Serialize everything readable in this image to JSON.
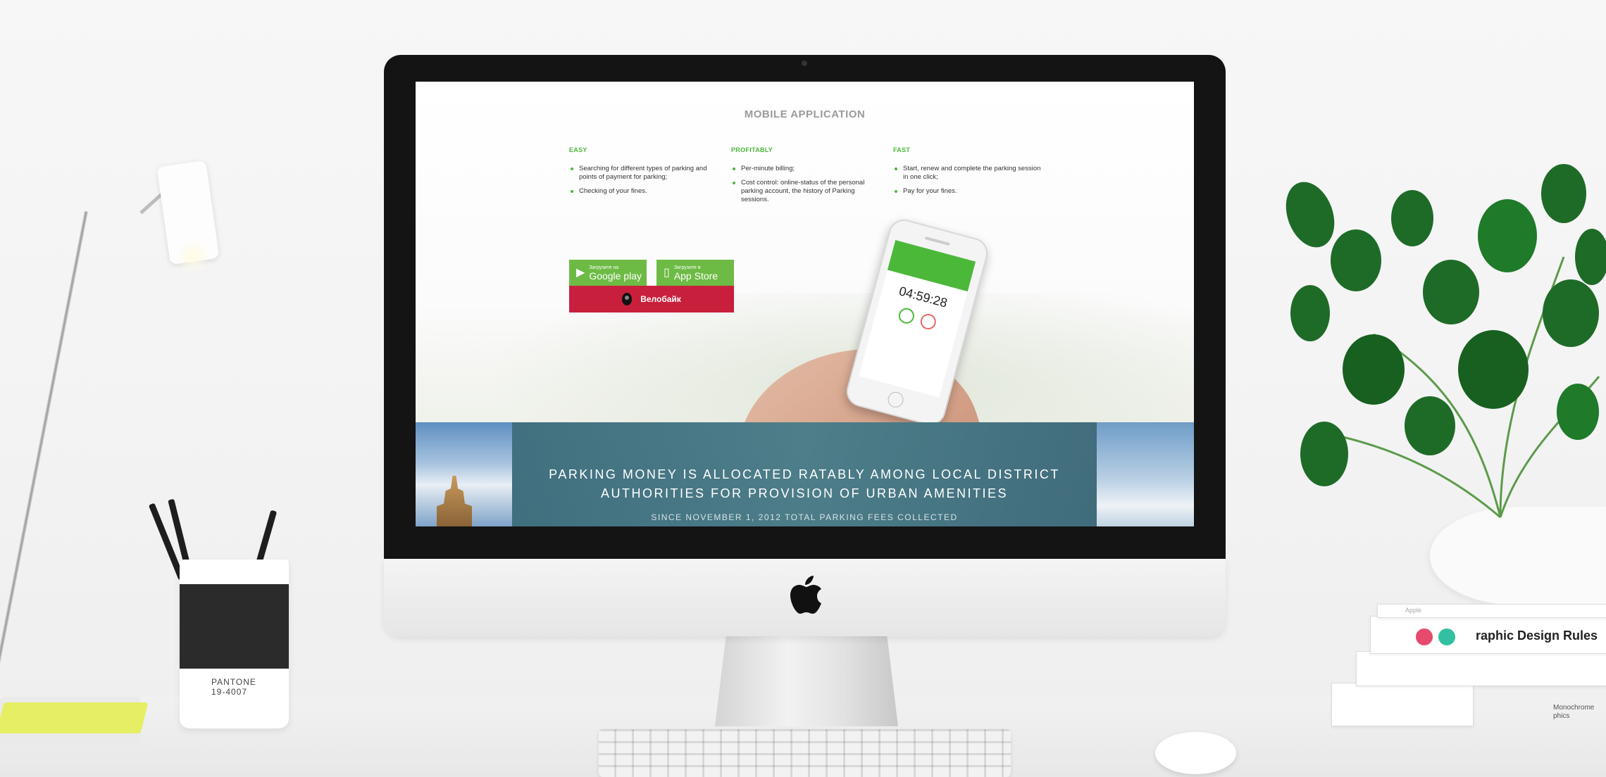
{
  "app": {
    "section_title": "MOBILE APPLICATION",
    "columns": [
      {
        "heading": "EASY",
        "items": [
          "Searching for different types of parking and points of payment for parking;",
          "Checking of your fines."
        ]
      },
      {
        "heading": "PROFITABLY",
        "items": [
          "Per-minute billing;",
          "Cost control: online-status of the personal parking account, the history of Parking sessions."
        ]
      },
      {
        "heading": "FAST",
        "items": [
          "Start, renew and complete the parking session in one click;",
          "Pay for your fines."
        ]
      }
    ],
    "google_play": {
      "small": "Загрузите на",
      "big": "Google play"
    },
    "app_store": {
      "small": "Загрузите в",
      "big": "App Store"
    },
    "velobike_label": "Велобайк",
    "phone_timer": "04:59:28",
    "banner": {
      "title_line1": "PARKING MONEY IS ALLOCATED RATABLY AMONG LOCAL DISTRICT",
      "title_line2": "AUTHORITIES FOR PROVISION OF URBAN AMENITIES",
      "subtitle": "SINCE NOVEMBER 1, 2012 TOTAL PARKING FEES COLLECTED"
    }
  },
  "scene": {
    "cup_brand": "PANTONE",
    "cup_code": "19-4007",
    "book_title": "raphic Design Rules",
    "book_sub": "Monochrome phics",
    "book_top_label": "Apple"
  },
  "colors": {
    "accent_green": "#4cb83a",
    "store_green": "#6dbb45",
    "velobike_red": "#c8203c",
    "banner_teal": "#4c7d88"
  },
  "icons": [
    "google-play-icon",
    "app-store-icon",
    "velobike-pin-icon",
    "apple-logo-icon"
  ]
}
